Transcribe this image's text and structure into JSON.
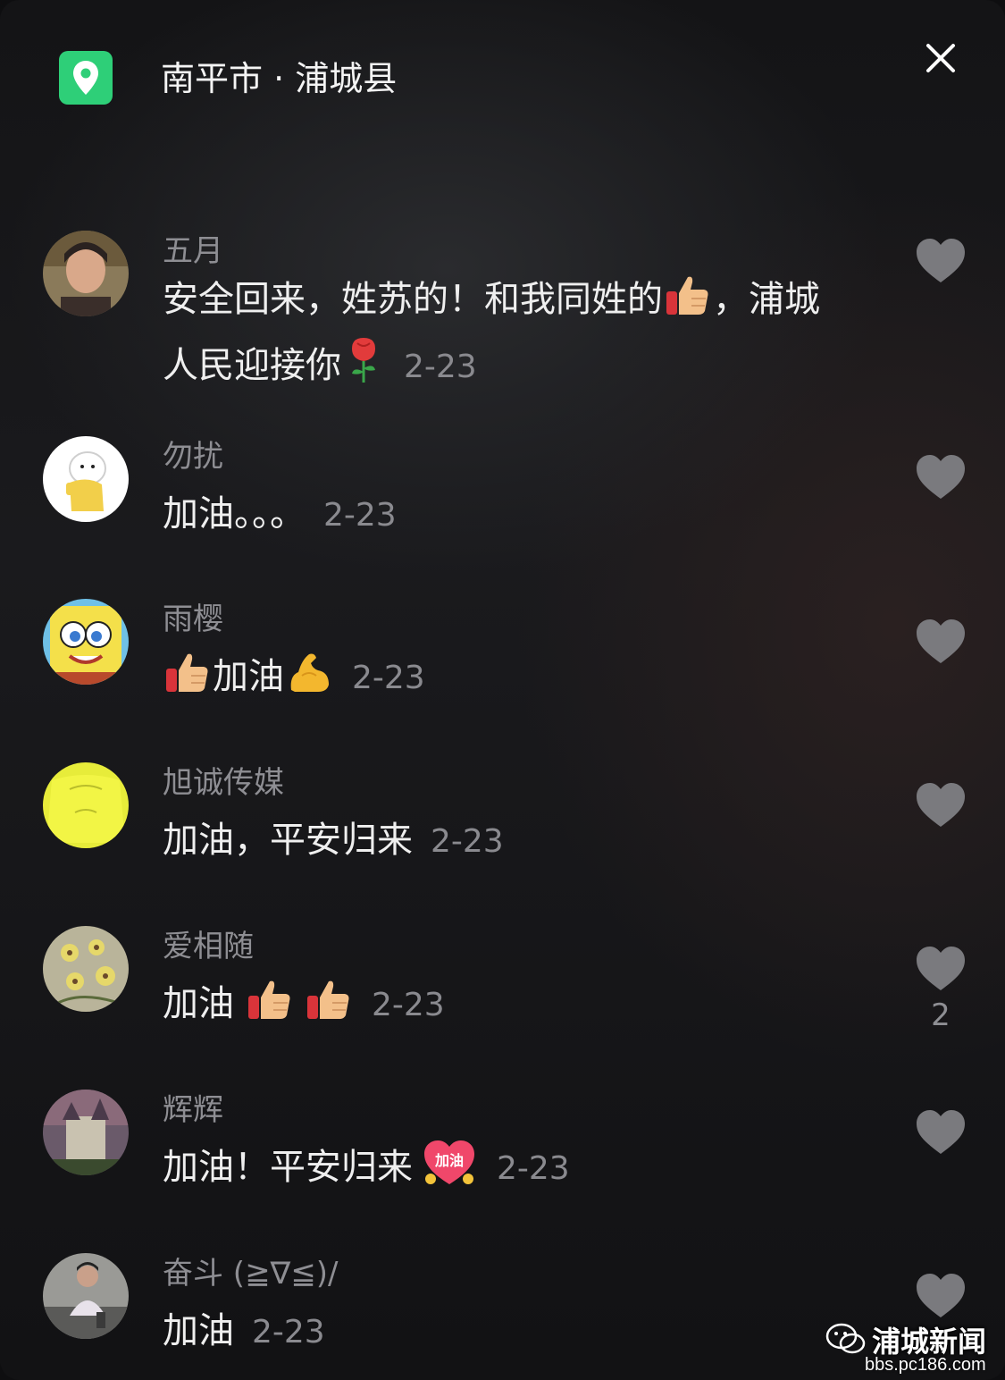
{
  "header": {
    "location": "南平市 · 浦城县",
    "location_icon": "map-pin-icon",
    "close_icon": "close-icon"
  },
  "comments": [
    {
      "username": "五月",
      "text_a": "安全回来，姓苏的！和我同姓的",
      "text_b": "，浦城人民迎接你",
      "date": "2-23",
      "emojis": [
        "thumbs-up-icon",
        "rose-icon"
      ],
      "likes": ""
    },
    {
      "username": "勿扰",
      "text_a": "加油。。。",
      "date": "2-23",
      "likes": ""
    },
    {
      "username": "雨樱",
      "text_a": "加油",
      "date": "2-23",
      "emojis": [
        "thumbs-up-icon",
        "flexed-biceps-icon"
      ],
      "likes": ""
    },
    {
      "username": "旭诚传媒",
      "text_a": "加油，平安归来",
      "date": "2-23",
      "likes": ""
    },
    {
      "username": "爱相随",
      "text_a": "加油",
      "date": "2-23",
      "emojis": [
        "thumbs-up-icon",
        "thumbs-up-icon"
      ],
      "likes": "2"
    },
    {
      "username": "辉辉",
      "text_a": "加油！平安归来",
      "date": "2-23",
      "emojis": [
        "jiayou-heart-sticker-icon"
      ],
      "sticker_text": "加油",
      "likes": ""
    },
    {
      "username": "奋斗 (≧∇≦)/",
      "text_a": "加油",
      "date": "2-23",
      "likes": ""
    }
  ],
  "watermark": {
    "title": "浦城新闻",
    "url": "bbs.pc186.com"
  },
  "colors": {
    "accent": "#2ecf78",
    "username": "#8e8e93",
    "heart": "#7a7a7e"
  }
}
